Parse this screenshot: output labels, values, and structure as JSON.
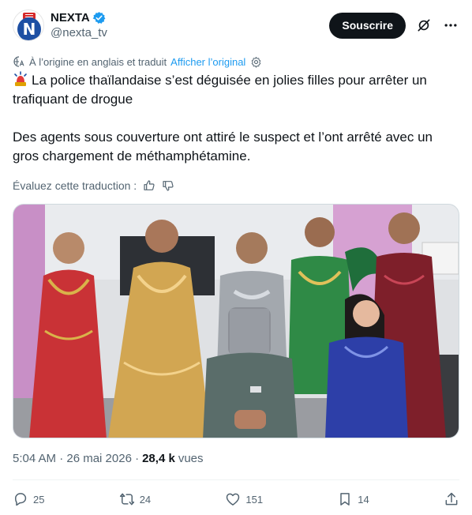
{
  "header": {
    "display_name": "NEXTA",
    "handle": "@nexta_tv",
    "avatar_letter": "N",
    "subscribe_label": "Souscrire"
  },
  "translation": {
    "notice": "À l’origine en anglais et traduit",
    "show_original": "Afficher l’original"
  },
  "tweet": {
    "line1": "La police thaïlandaise s’est déguisée en jolies filles pour arrêter un trafiquant de drogue",
    "line2": "Des agents sous couverture ont attiré le suspect et l’ont arrêté avec un gros chargement de méthamphétamine."
  },
  "rate": {
    "label": "Évaluez cette traduction :"
  },
  "meta": {
    "timestamp": "5:04 AM · 26 mai 2026 · ",
    "views_count": "28,4 k",
    "views_label": "vues"
  },
  "actions": {
    "replies": "25",
    "reposts": "24",
    "likes": "151",
    "bookmarks": "14"
  },
  "colors": {
    "accent": "#1d9bf0",
    "text": "#0f1419",
    "secondary": "#536471",
    "brand": "#1d4fa3"
  }
}
